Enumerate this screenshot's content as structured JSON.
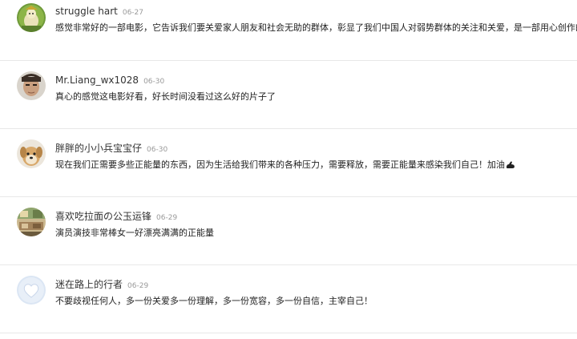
{
  "comments": [
    {
      "username": "struggle hart",
      "date": "06-27",
      "text": "感觉非常好的一部电影，它告诉我们要关爱家人朋友和社会无助的群体，彰显了我们中国人对弱势群体的关注和关爱，是一部用心创作的作品",
      "avatar": "green-character-avatar"
    },
    {
      "username": "Mr.Liang_wx1028",
      "date": "06-30",
      "text": "真心的感觉这电影好看，好长时间没看过这么好的片子了",
      "avatar": "person-photo-avatar"
    },
    {
      "username": "胖胖的小小兵宝宝仔",
      "date": "06-30",
      "text": "现在我们正需要多些正能量的东西，因为生活给我们带来的各种压力，需要释放，需要正能量来感染我们自己！加油",
      "avatar": "puppy-photo-avatar",
      "trailing_emoji": "flexed-arm-emoji"
    },
    {
      "username": "喜欢吃拉面の公玉运锋",
      "date": "06-29",
      "text": "演员演技非常棒女一好漂亮满满的正能量",
      "avatar": "room-photo-avatar"
    },
    {
      "username": "迷在路上的行者",
      "date": "06-29",
      "text": "不要歧视任何人，多一份关爱多一份理解，多一份宽容，多一份自信，主宰自己！",
      "avatar": "heart-avatar"
    }
  ]
}
